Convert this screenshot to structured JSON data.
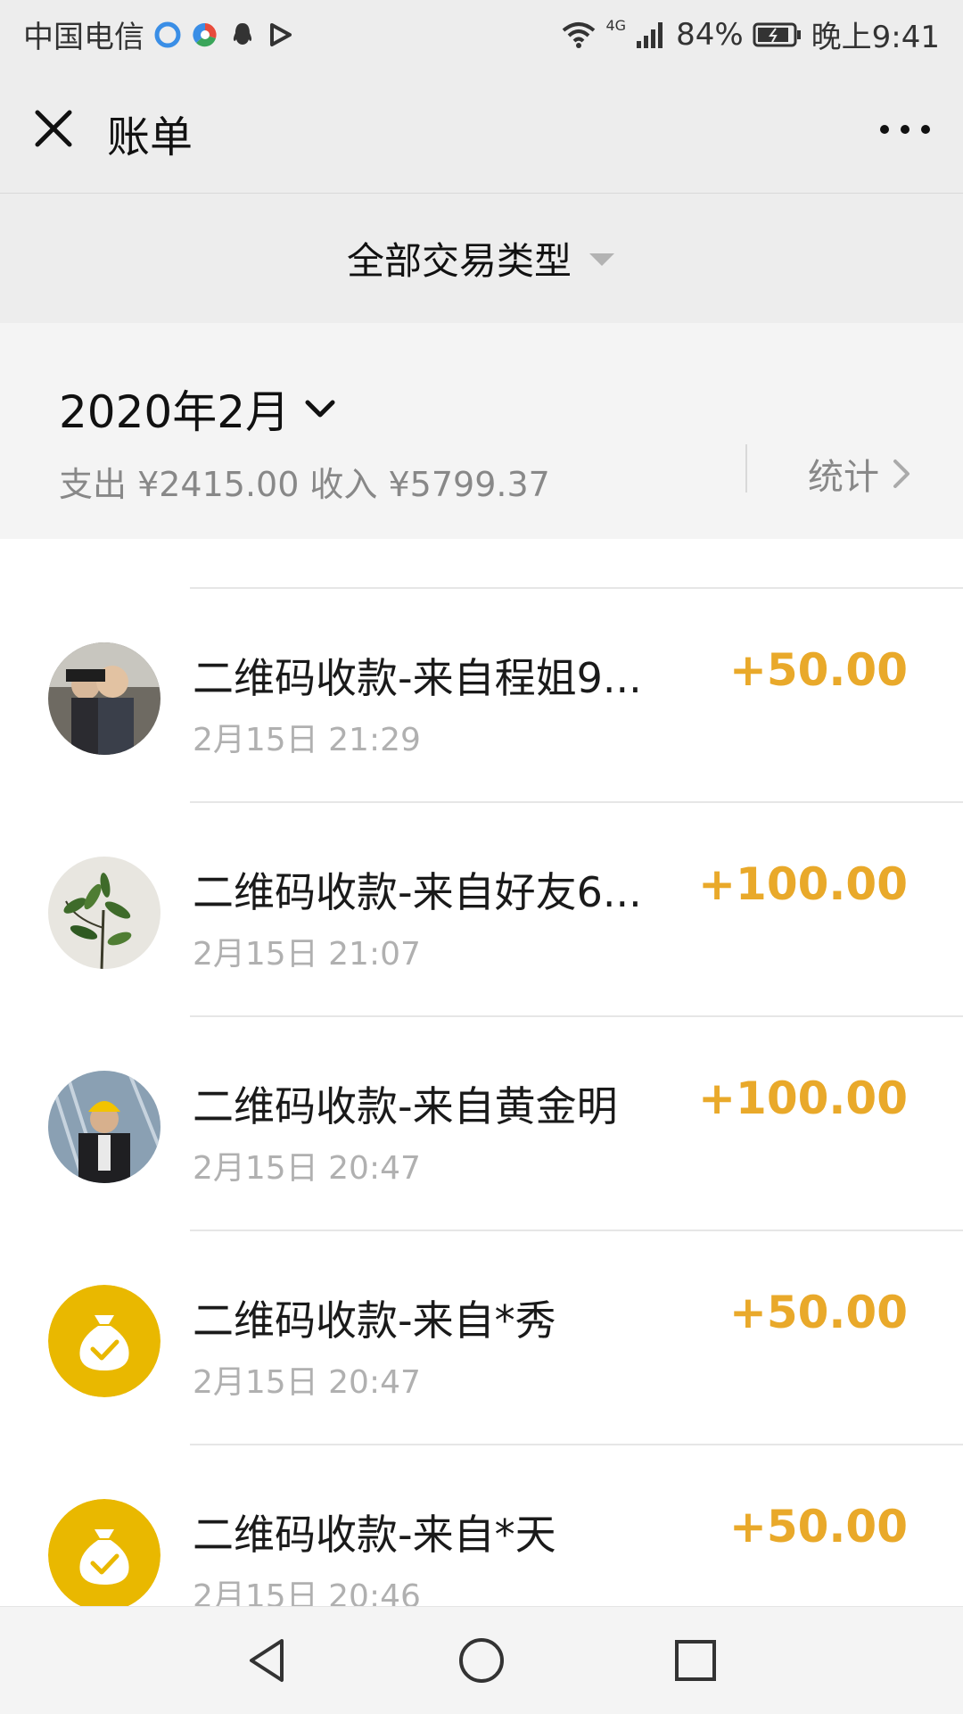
{
  "status_bar": {
    "carrier": "中国电信",
    "battery": "84%",
    "network": "4G",
    "time": "晚上9:41"
  },
  "nav": {
    "title": "账单"
  },
  "filter": {
    "label": "全部交易类型"
  },
  "summary": {
    "month": "2020年2月",
    "expense": "支出 ¥2415.00",
    "income": "收入 ¥5799.37",
    "stats_label": "统计"
  },
  "transactions": [
    {
      "title": "二维码收款-来自程姐9...",
      "time": "2月15日 21:29",
      "amount": "+50.00",
      "avatar": "photo-kids"
    },
    {
      "title": "二维码收款-来自好友6...",
      "time": "2月15日 21:07",
      "amount": "+100.00",
      "avatar": "photo-plant"
    },
    {
      "title": "二维码收款-来自黄金明",
      "time": "2月15日 20:47",
      "amount": "+100.00",
      "avatar": "photo-worker"
    },
    {
      "title": "二维码收款-来自*秀",
      "time": "2月15日 20:47",
      "amount": "+50.00",
      "avatar": "money-bag-icon"
    },
    {
      "title": "二维码收款-来自*天",
      "time": "2月15日 20:46",
      "amount": "+50.00",
      "avatar": "money-bag-icon"
    }
  ],
  "colors": {
    "amount": "#e9a92a",
    "money_bag_bg": "#e9b800",
    "nav_bg": "#ededed"
  }
}
